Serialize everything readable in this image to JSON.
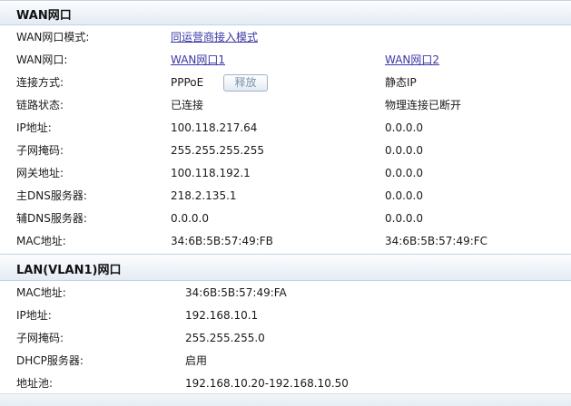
{
  "wan": {
    "title": "WAN网口",
    "rows": {
      "mode": {
        "label": "WAN网口模式:",
        "value": "同运营商接入模式"
      },
      "port": {
        "label": "WAN网口:",
        "wan1": "WAN网口1",
        "wan2": "WAN网口2"
      },
      "conn": {
        "label": "连接方式:",
        "wan1": "PPPoE",
        "button": "释放",
        "wan2": "静态IP"
      },
      "link": {
        "label": "链路状态:",
        "wan1": "已连接",
        "wan2": "物理连接已断开"
      },
      "ip": {
        "label": "IP地址:",
        "wan1": "100.118.217.64",
        "wan2": "0.0.0.0"
      },
      "mask": {
        "label": "子网掩码:",
        "wan1": "255.255.255.255",
        "wan2": "0.0.0.0"
      },
      "gw": {
        "label": "网关地址:",
        "wan1": "100.118.192.1",
        "wan2": "0.0.0.0"
      },
      "dns1": {
        "label": "主DNS服务器:",
        "wan1": "218.2.135.1",
        "wan2": "0.0.0.0"
      },
      "dns2": {
        "label": "辅DNS服务器:",
        "wan1": "0.0.0.0",
        "wan2": "0.0.0.0"
      },
      "mac": {
        "label": "MAC地址:",
        "wan1": "34:6B:5B:57:49:FB",
        "wan2": "34:6B:5B:57:49:FC"
      }
    }
  },
  "lan": {
    "title": "LAN(VLAN1)网口",
    "rows": {
      "mac": {
        "label": "MAC地址:",
        "value": "34:6B:5B:57:49:FA"
      },
      "ip": {
        "label": "IP地址:",
        "value": "192.168.10.1"
      },
      "mask": {
        "label": "子网掩码:",
        "value": "255.255.255.0"
      },
      "dhcp": {
        "label": "DHCP服务器:",
        "value": "启用"
      },
      "pool": {
        "label": "地址池:",
        "value": "192.168.10.20-192.168.10.50"
      }
    }
  }
}
